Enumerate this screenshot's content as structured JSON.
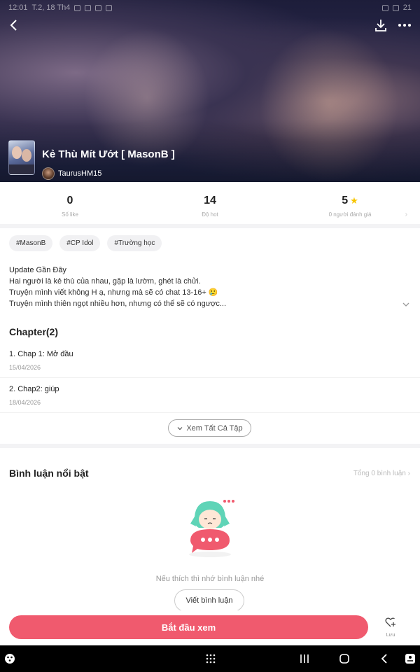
{
  "status_bar": {
    "time": "12:01",
    "date": "T.2, 18 Th4",
    "battery": "21"
  },
  "book": {
    "title": "Kẻ Thù Mít Ướt [ MasonB ]",
    "author": "TaurusHM15"
  },
  "stats": [
    {
      "value": "0",
      "label": "Số like"
    },
    {
      "value": "14",
      "label": "Độ hot"
    },
    {
      "value": "5",
      "label": "0 người đánh giá"
    }
  ],
  "tags": [
    "#MasonB",
    "#CP Idol",
    "#Trường học"
  ],
  "description": {
    "title": "Update Gần Đây",
    "lines": [
      "Hai người là kẻ thù của nhau, gặp là lườm, ghét là chửi.",
      "Truyện mình viết không H ạ, nhưng mà sẽ có chat 13-16+ 🥲",
      "Truyện mình thiên ngọt nhiều hơn, nhưng có thể sẽ có ngược..."
    ]
  },
  "chapters": {
    "header": "Chapter(2)",
    "items": [
      {
        "title": "1. Chap 1: Mở đầu",
        "date": "15/04/2026"
      },
      {
        "title": "2. Chap2: giúp",
        "date": "18/04/2026"
      }
    ],
    "see_all": "Xem Tất Cả Tập"
  },
  "comments": {
    "header": "Bình luận nổi bật",
    "total": "Tổng 0 bình luận",
    "hint": "Nếu thích thì nhớ bình luận nhé",
    "write_button": "Viết bình luận"
  },
  "bottom": {
    "start_button": "Bắt đầu xem",
    "save_label": "Lưu"
  },
  "colors": {
    "accent": "#f05a6e",
    "star": "#f7c500"
  }
}
